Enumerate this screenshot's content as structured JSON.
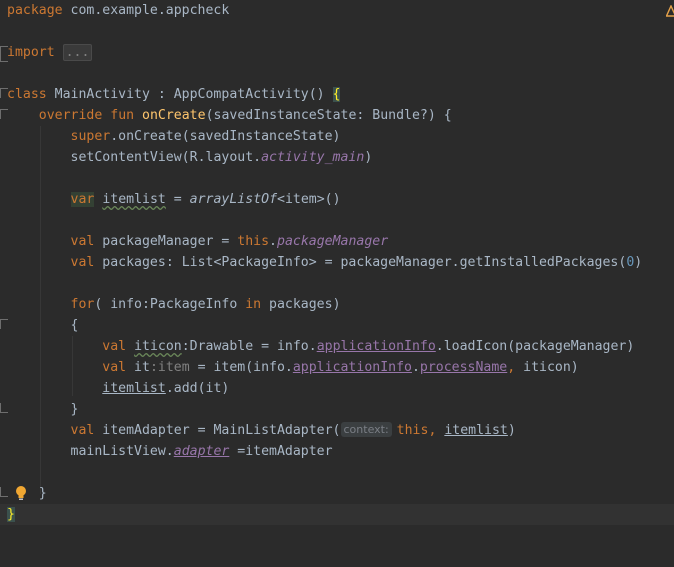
{
  "colors": {
    "background": "#2b2b2b",
    "keyword": "#cc7832",
    "function": "#ffc66d",
    "property": "#9876aa",
    "number": "#6897bb",
    "text": "#a9b7c6"
  },
  "lines": {
    "l1": {
      "kw": "package",
      "rest": " com.example.appcheck"
    },
    "l3": {
      "kw": "import",
      "folded": "..."
    },
    "l5": {
      "kw": "class",
      "rest": " MainActivity : AppCompatActivity() ",
      "brace": "{"
    },
    "l6": {
      "kw1": "override",
      "kw2": "fun",
      "fn": "onCreate",
      "rest": "(savedInstanceState: Bundle?) {"
    },
    "l7": {
      "kw": "super",
      "rest": ".onCreate(savedInstanceState)"
    },
    "l8": {
      "a": "setContentView(R.layout.",
      "prop": "activity_main",
      "b": ")"
    },
    "l10": {
      "kw": "var",
      "name": "itemlist",
      "eq": " = ",
      "call": "arrayListOf",
      "rest": "<item>()"
    },
    "l12": {
      "kw": "val",
      "a": " packageManager = ",
      "kw2": "this",
      "dot": ".",
      "prop": "packageManager"
    },
    "l13": {
      "kw": "val",
      "a": " packages: List<PackageInfo> = packageManager.getInstalledPackages(",
      "num": "0",
      "b": ")"
    },
    "l15": {
      "kw": "for",
      "a": "( info:PackageInfo ",
      "kw2": "in",
      "b": " packages)"
    },
    "l16": {
      "text": "{"
    },
    "l17": {
      "kw": "val",
      "name": "iticon",
      "a": ":Drawable = info.",
      "prop": "applicationInfo",
      "b": ".loadIcon(packageManager)"
    },
    "l18": {
      "kw": "val",
      "a": " it",
      "type": ":item",
      "b": " = item(info.",
      "prop1": "applicationInfo",
      "dot": ".",
      "prop2": "processName",
      "comma": ",",
      "c": " iticon)"
    },
    "l19": {
      "name": "itemlist",
      "rest": ".add(it)"
    },
    "l20": {
      "text": "}"
    },
    "l21": {
      "kw": "val",
      "a": " itemAdapter = MainListAdapter(",
      "hint": "context:",
      "kw2": "this",
      "comma": ",",
      "name": "itemlist",
      "b": ")"
    },
    "l22": {
      "a": "mainListView.",
      "prop": "adapter",
      "b": " =itemAdapter"
    },
    "l24": {
      "text": "}"
    },
    "l25": {
      "text": "}"
    }
  },
  "icons": {
    "warning": "warning-icon",
    "bulb": "lightbulb-icon"
  }
}
